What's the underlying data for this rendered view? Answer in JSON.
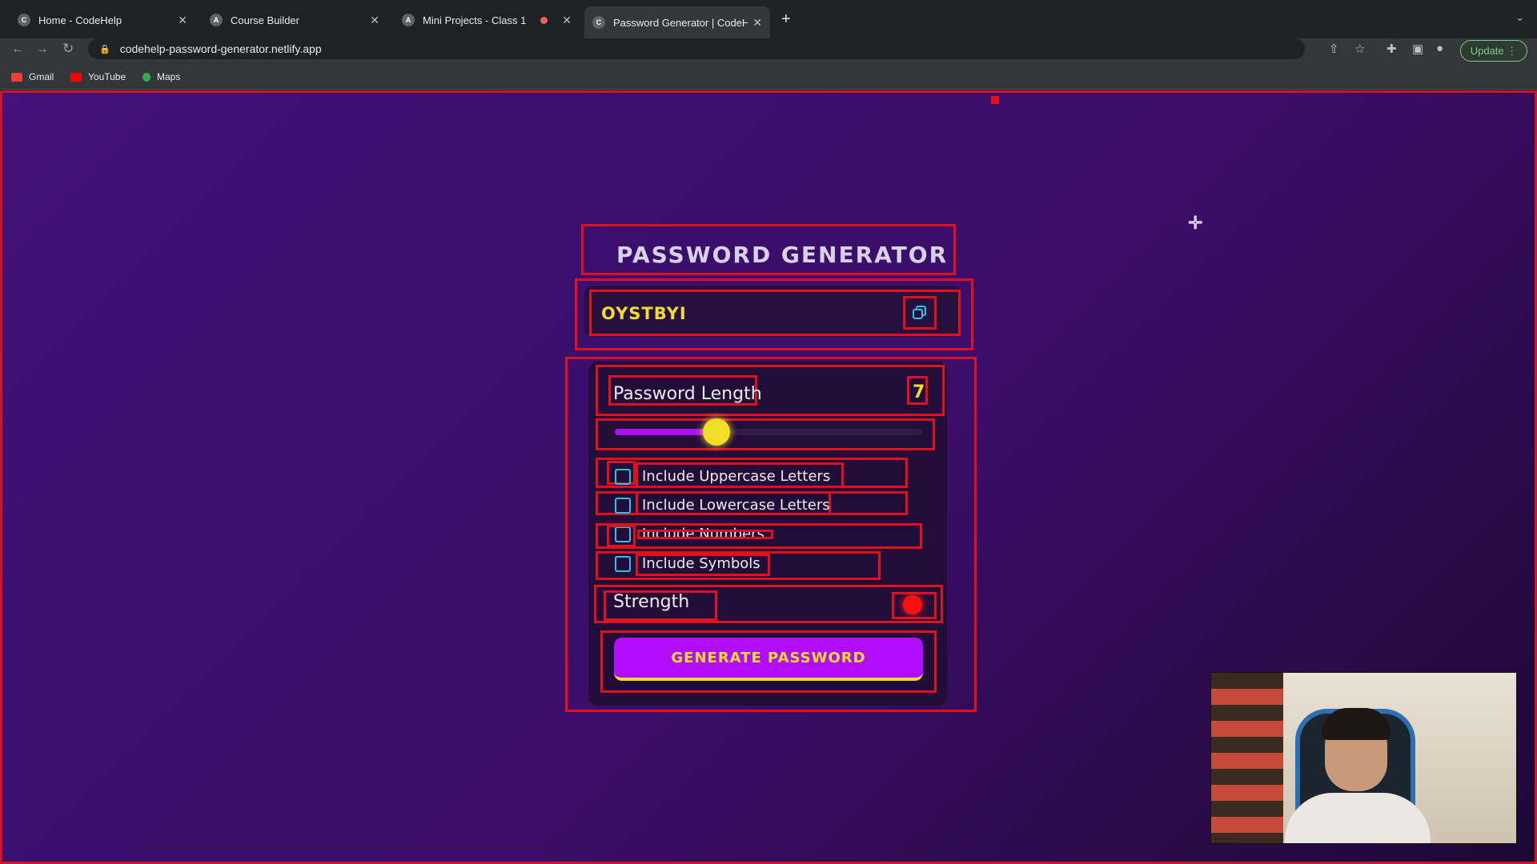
{
  "browser": {
    "tabs": [
      {
        "label": "Home - CodeHelp",
        "active": false
      },
      {
        "label": "Course Builder",
        "active": false
      },
      {
        "label": "Mini Projects - Class 1",
        "active": false,
        "recording": true
      },
      {
        "label": "Password Generator | CodeHel",
        "active": true
      }
    ],
    "url": "codehelp-password-generator.netlify.app",
    "update_label": "Update",
    "bookmarks": [
      {
        "label": "Gmail",
        "color": "#ea4335"
      },
      {
        "label": "YouTube",
        "color": "#ff0000"
      },
      {
        "label": "Maps",
        "color": "#34a853"
      }
    ]
  },
  "app": {
    "title": "PASSWORD GENERATOR",
    "password": "OYSTBYI",
    "length_label": "Password Length",
    "length_value": "7",
    "slider": {
      "fill_fraction": 0.33
    },
    "checkboxes": [
      {
        "label": "Include Uppercase Letters",
        "checked": false
      },
      {
        "label": "Include Lowercase Letters",
        "checked": false
      },
      {
        "label": "Include Numbers",
        "checked": false
      },
      {
        "label": "Include Symbols",
        "checked": false
      }
    ],
    "strength_label": "Strength",
    "strength_color": "#ff1010",
    "generate_label": "GENERATE PASSWORD"
  },
  "colors": {
    "accent_yellow": "#f3dd2a",
    "accent_purple": "#b20dff",
    "checkbox_border": "#27c6e6",
    "overlay_red": "#e0101f"
  }
}
